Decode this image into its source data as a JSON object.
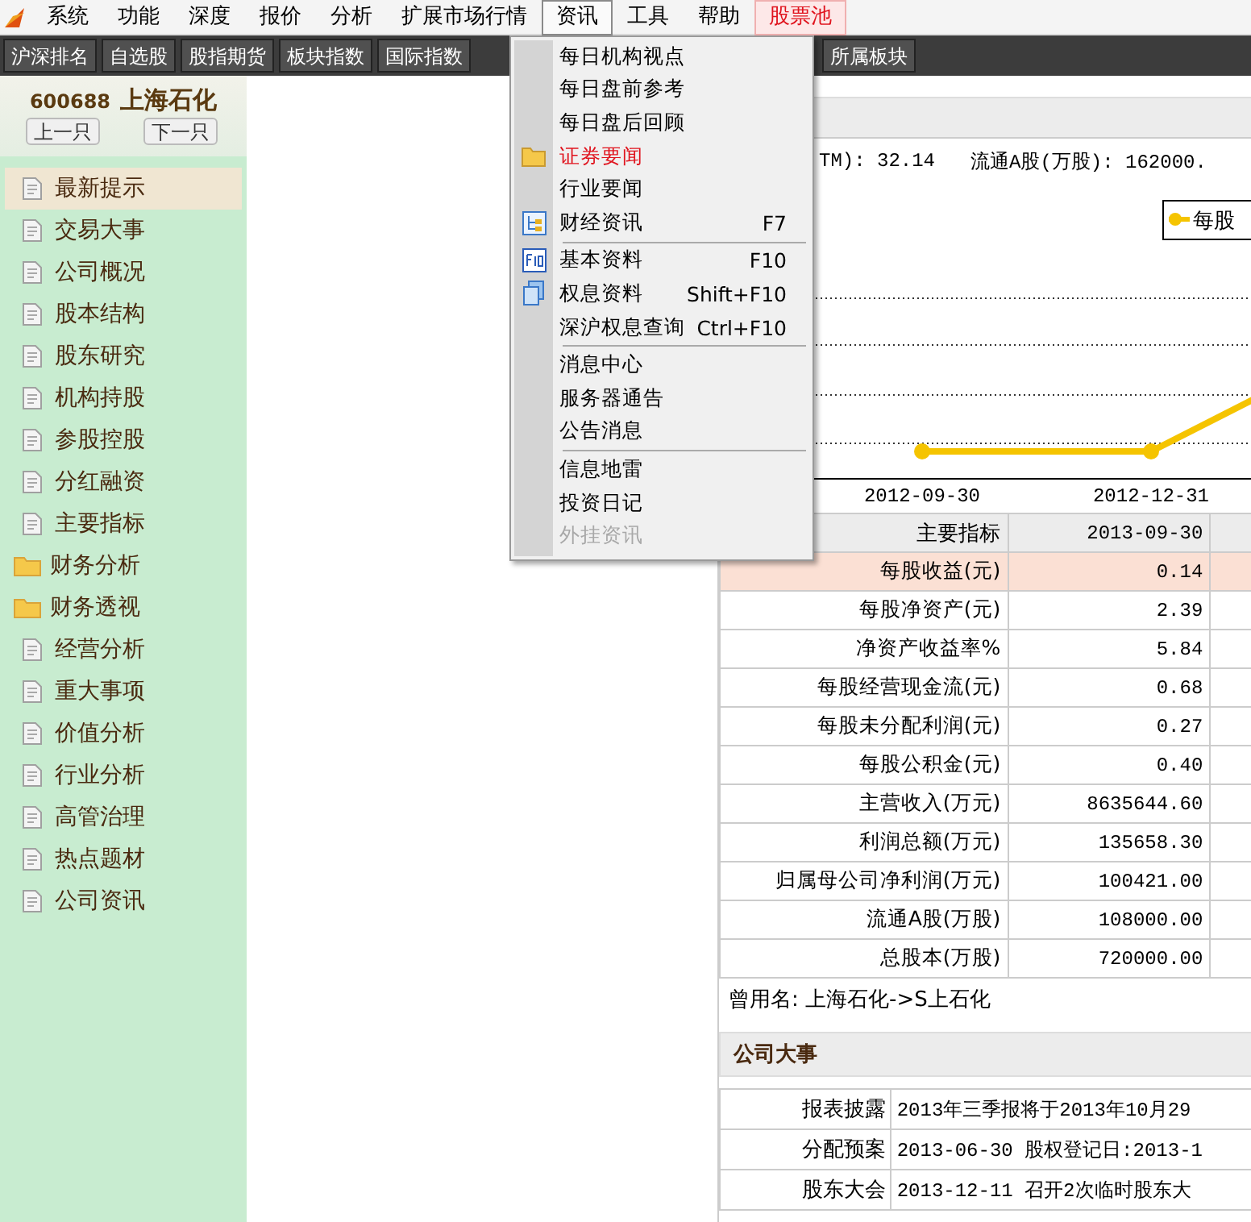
{
  "menu_bar": {
    "items": [
      {
        "label": "系统",
        "selected": false,
        "kind": "normal"
      },
      {
        "label": "功能",
        "selected": false,
        "kind": "normal"
      },
      {
        "label": "深度",
        "selected": false,
        "kind": "normal"
      },
      {
        "label": "报价",
        "selected": false,
        "kind": "normal"
      },
      {
        "label": "分析",
        "selected": false,
        "kind": "normal"
      },
      {
        "label": "扩展市场行情",
        "selected": false,
        "kind": "normal"
      },
      {
        "label": "资讯",
        "selected": true,
        "kind": "normal"
      },
      {
        "label": "工具",
        "selected": false,
        "kind": "normal"
      },
      {
        "label": "帮助",
        "selected": false,
        "kind": "normal"
      },
      {
        "label": "股票池",
        "selected": false,
        "kind": "highlight"
      }
    ]
  },
  "toolbar": {
    "left": [
      "沪深排名",
      "自选股",
      "股指期货",
      "板块指数",
      "国际指数"
    ],
    "right": [
      "所属板块"
    ]
  },
  "dropdown": {
    "groups": [
      [
        {
          "label": "每日机构视点",
          "kind": "plain",
          "highlighted": false,
          "disabled": false
        },
        {
          "label": "每日盘前参考",
          "kind": "plain",
          "highlighted": false,
          "disabled": false
        },
        {
          "label": "每日盘后回顾",
          "kind": "plain",
          "highlighted": false,
          "disabled": false
        },
        {
          "label": "证券要闻",
          "kind": "folder",
          "highlighted": true,
          "disabled": false
        },
        {
          "label": "行业要闻",
          "kind": "plain",
          "highlighted": false,
          "disabled": false
        },
        {
          "label": "财经资讯",
          "shortcut": "F7",
          "kind": "tree",
          "highlighted": false,
          "disabled": false
        }
      ],
      [
        {
          "label": "基本资料",
          "shortcut": "F10",
          "kind": "key",
          "highlighted": false,
          "disabled": false
        },
        {
          "label": "权息资料",
          "shortcut": "Shift+F10",
          "kind": "pages",
          "highlighted": false,
          "disabled": false
        },
        {
          "label": "深沪权息查询",
          "shortcut": "Ctrl+F10",
          "kind": "plain",
          "highlighted": false,
          "disabled": false
        }
      ],
      [
        {
          "label": "消息中心",
          "kind": "plain",
          "highlighted": false,
          "disabled": false
        },
        {
          "label": "服务器通告",
          "kind": "plain",
          "highlighted": false,
          "disabled": false
        },
        {
          "label": "公告消息",
          "kind": "plain",
          "highlighted": false,
          "disabled": false
        }
      ],
      [
        {
          "label": "信息地雷",
          "kind": "plain",
          "highlighted": false,
          "disabled": false
        },
        {
          "label": "投资日记",
          "kind": "plain",
          "highlighted": false,
          "disabled": false
        },
        {
          "label": "外挂资讯",
          "kind": "plain",
          "highlighted": false,
          "disabled": true
        }
      ]
    ]
  },
  "sidebar": {
    "code": "600688",
    "name": "上海石化",
    "buttons": [
      "上一只",
      "下一只"
    ],
    "items": [
      {
        "label": "最新提示",
        "kind": "page",
        "selected": true
      },
      {
        "label": "交易大事",
        "kind": "page",
        "selected": false
      },
      {
        "label": "公司概况",
        "kind": "page",
        "selected": false
      },
      {
        "label": "股本结构",
        "kind": "page",
        "selected": false
      },
      {
        "label": "股东研究",
        "kind": "page",
        "selected": false
      },
      {
        "label": "机构持股",
        "kind": "page",
        "selected": false
      },
      {
        "label": "参股控股",
        "kind": "page",
        "selected": false
      },
      {
        "label": "分红融资",
        "kind": "page",
        "selected": false
      },
      {
        "label": "主要指标",
        "kind": "page",
        "selected": false
      },
      {
        "label": "财务分析",
        "kind": "folder",
        "selected": false
      },
      {
        "label": "财务透视",
        "kind": "folder",
        "selected": false
      },
      {
        "label": "经营分析",
        "kind": "page",
        "selected": false
      },
      {
        "label": "重大事项",
        "kind": "page",
        "selected": false
      },
      {
        "label": "价值分析",
        "kind": "page",
        "selected": false
      },
      {
        "label": "行业分析",
        "kind": "page",
        "selected": false
      },
      {
        "label": "高管治理",
        "kind": "page",
        "selected": false
      },
      {
        "label": "热点题材",
        "kind": "page",
        "selected": false
      },
      {
        "label": "公司资讯",
        "kind": "page",
        "selected": false
      }
    ]
  },
  "summary": {
    "info": [
      "TM): 32.14",
      "流通A股(万股): 162000."
    ],
    "chart": {
      "legend": "每股",
      "x_labels": [
        "2012-09-30",
        "2012-12-31"
      ]
    }
  },
  "indicators": {
    "columns": [
      "主要指标",
      "2013-09-30"
    ],
    "rows": [
      {
        "label": "每股收益(元)",
        "value": "0.14",
        "selected": true
      },
      {
        "label": "每股净资产(元)",
        "value": "2.39",
        "selected": false
      },
      {
        "label": "净资产收益率%",
        "value": "5.84",
        "selected": false
      },
      {
        "label": "每股经营现金流(元)",
        "value": "0.68",
        "selected": false
      },
      {
        "label": "每股未分配利润(元)",
        "value": "0.27",
        "selected": false
      },
      {
        "label": "每股公积金(元)",
        "value": "0.40",
        "selected": false
      },
      {
        "label": "主营收入(万元)",
        "value": "8635644.60",
        "selected": false
      },
      {
        "label": "利润总额(万元)",
        "value": "135658.30",
        "selected": false
      },
      {
        "label": "归属母公司净利润(万元)",
        "value": "100421.00",
        "selected": false
      },
      {
        "label": "流通A股(万股)",
        "value": "108000.00",
        "selected": false
      },
      {
        "label": "总股本(万股)",
        "value": "720000.00",
        "selected": false
      }
    ]
  },
  "former_name": "曾用名: 上海石化->S上石化",
  "events": {
    "title": "公司大事",
    "rows": [
      {
        "label": "报表披露",
        "text": "2013年三季报将于2013年10月29"
      },
      {
        "label": "分配预案",
        "text": "2013-06-30 股权登记日:2013-1"
      },
      {
        "label": "股东大会",
        "text": "2013-12-11 召开2次临时股东大"
      }
    ]
  }
}
